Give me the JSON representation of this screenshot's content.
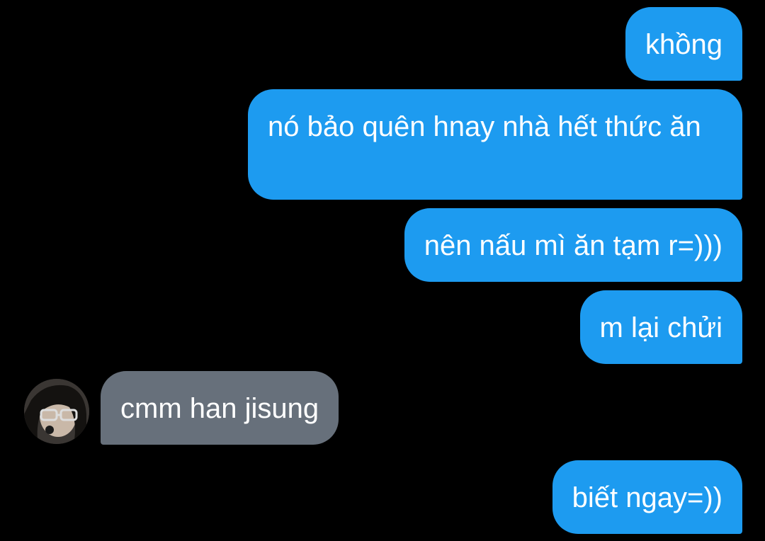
{
  "conversation": {
    "messages": [
      {
        "text": "khồng",
        "from": "me"
      },
      {
        "text": "nó bảo quên hnay nhà hết thức ăn",
        "from": "me"
      },
      {
        "text": "nên nấu mì ăn tạm r=)))",
        "from": "me"
      },
      {
        "text": "m lại chửi",
        "from": "me"
      },
      {
        "text": "cmm han jisung",
        "from": "them"
      },
      {
        "text": "biết ngay=))",
        "from": "me"
      }
    ],
    "colors": {
      "background": "#000000",
      "outgoing_bubble": "#1d9bf0",
      "incoming_bubble": "#67707b",
      "text": "#ffffff"
    }
  }
}
